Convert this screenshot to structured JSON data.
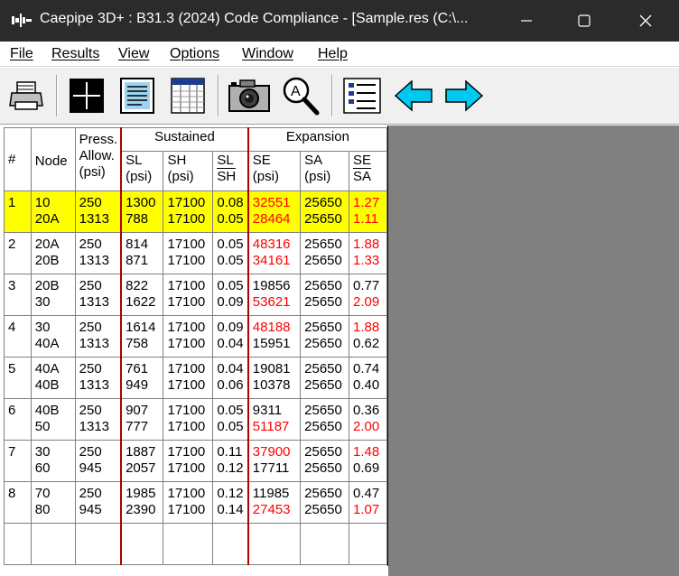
{
  "window": {
    "title": "Caepipe 3D+ : B31.3 (2024) Code Compliance -  [Sample.res (C:\\...",
    "minimize_glyph": "—",
    "maximize_glyph": "☐",
    "close_glyph": "✕"
  },
  "menu": [
    "File",
    "Results",
    "View",
    "Options",
    "Window",
    "Help"
  ],
  "toolbar": {
    "buttons": [
      "print-icon",
      "crosshair-icon",
      "text-document-icon",
      "table-icon",
      "camera-icon",
      "zoom-icon",
      "list-icon",
      "arrow-left-icon",
      "arrow-right-icon"
    ]
  },
  "table": {
    "headers": {
      "num": "#",
      "node": "Node",
      "press_top": "Press.",
      "press_allow": "Allow.",
      "press_unit": "(psi)",
      "sustained": "Sustained",
      "expansion": "Expansion",
      "sl": "SL",
      "sl_unit": "(psi)",
      "sh": "SH",
      "sh_unit": "(psi)",
      "sl_sh_num": "SL",
      "sl_sh_den": "SH",
      "se": "SE",
      "se_unit": "(psi)",
      "sa": "SA",
      "sa_unit": "(psi)",
      "se_sa_num": "SE",
      "se_sa_den": "SA"
    },
    "rows": [
      {
        "num": "1",
        "node": [
          "10",
          "20A"
        ],
        "press": [
          "250",
          "1313"
        ],
        "sl": [
          "1300",
          "788"
        ],
        "sh": [
          "17100",
          "17100"
        ],
        "slsh": [
          "0.08",
          "0.05"
        ],
        "se": [
          "32551",
          "28464"
        ],
        "sa": [
          "25650",
          "25650"
        ],
        "sesa": [
          "1.27",
          "1.11"
        ]
      },
      {
        "num": "2",
        "node": [
          "20A",
          "20B"
        ],
        "press": [
          "250",
          "1313"
        ],
        "sl": [
          "814",
          "871"
        ],
        "sh": [
          "17100",
          "17100"
        ],
        "slsh": [
          "0.05",
          "0.05"
        ],
        "se": [
          "48316",
          "34161"
        ],
        "sa": [
          "25650",
          "25650"
        ],
        "sesa": [
          "1.88",
          "1.33"
        ]
      },
      {
        "num": "3",
        "node": [
          "20B",
          "30"
        ],
        "press": [
          "250",
          "1313"
        ],
        "sl": [
          "822",
          "1622"
        ],
        "sh": [
          "17100",
          "17100"
        ],
        "slsh": [
          "0.05",
          "0.09"
        ],
        "se": [
          "19856",
          "53621"
        ],
        "sa": [
          "25650",
          "25650"
        ],
        "sesa": [
          "0.77",
          "2.09"
        ]
      },
      {
        "num": "4",
        "node": [
          "30",
          "40A"
        ],
        "press": [
          "250",
          "1313"
        ],
        "sl": [
          "1614",
          "758"
        ],
        "sh": [
          "17100",
          "17100"
        ],
        "slsh": [
          "0.09",
          "0.04"
        ],
        "se": [
          "48188",
          "15951"
        ],
        "sa": [
          "25650",
          "25650"
        ],
        "sesa": [
          "1.88",
          "0.62"
        ]
      },
      {
        "num": "5",
        "node": [
          "40A",
          "40B"
        ],
        "press": [
          "250",
          "1313"
        ],
        "sl": [
          "761",
          "949"
        ],
        "sh": [
          "17100",
          "17100"
        ],
        "slsh": [
          "0.04",
          "0.06"
        ],
        "se": [
          "19081",
          "10378"
        ],
        "sa": [
          "25650",
          "25650"
        ],
        "sesa": [
          "0.74",
          "0.40"
        ]
      },
      {
        "num": "6",
        "node": [
          "40B",
          "50"
        ],
        "press": [
          "250",
          "1313"
        ],
        "sl": [
          "907",
          "777"
        ],
        "sh": [
          "17100",
          "17100"
        ],
        "slsh": [
          "0.05",
          "0.05"
        ],
        "se": [
          "9311",
          "51187"
        ],
        "sa": [
          "25650",
          "25650"
        ],
        "sesa": [
          "0.36",
          "2.00"
        ]
      },
      {
        "num": "7",
        "node": [
          "30",
          "60"
        ],
        "press": [
          "250",
          "945"
        ],
        "sl": [
          "1887",
          "2057"
        ],
        "sh": [
          "17100",
          "17100"
        ],
        "slsh": [
          "0.11",
          "0.12"
        ],
        "se": [
          "37900",
          "17711"
        ],
        "sa": [
          "25650",
          "25650"
        ],
        "sesa": [
          "1.48",
          "0.69"
        ]
      },
      {
        "num": "8",
        "node": [
          "70",
          "80"
        ],
        "press": [
          "250",
          "945"
        ],
        "sl": [
          "1985",
          "2390"
        ],
        "sh": [
          "17100",
          "17100"
        ],
        "slsh": [
          "0.12",
          "0.14"
        ],
        "se": [
          "11985",
          "27453"
        ],
        "sa": [
          "25650",
          "25650"
        ],
        "sesa": [
          "0.47",
          "1.07"
        ]
      }
    ]
  },
  "colors": {
    "highlight_row": "#ffff00",
    "overstress_text": "#ff0000",
    "group_divider": "#b00000",
    "titlebar": "#2b2b2b",
    "workspace": "#808080"
  }
}
